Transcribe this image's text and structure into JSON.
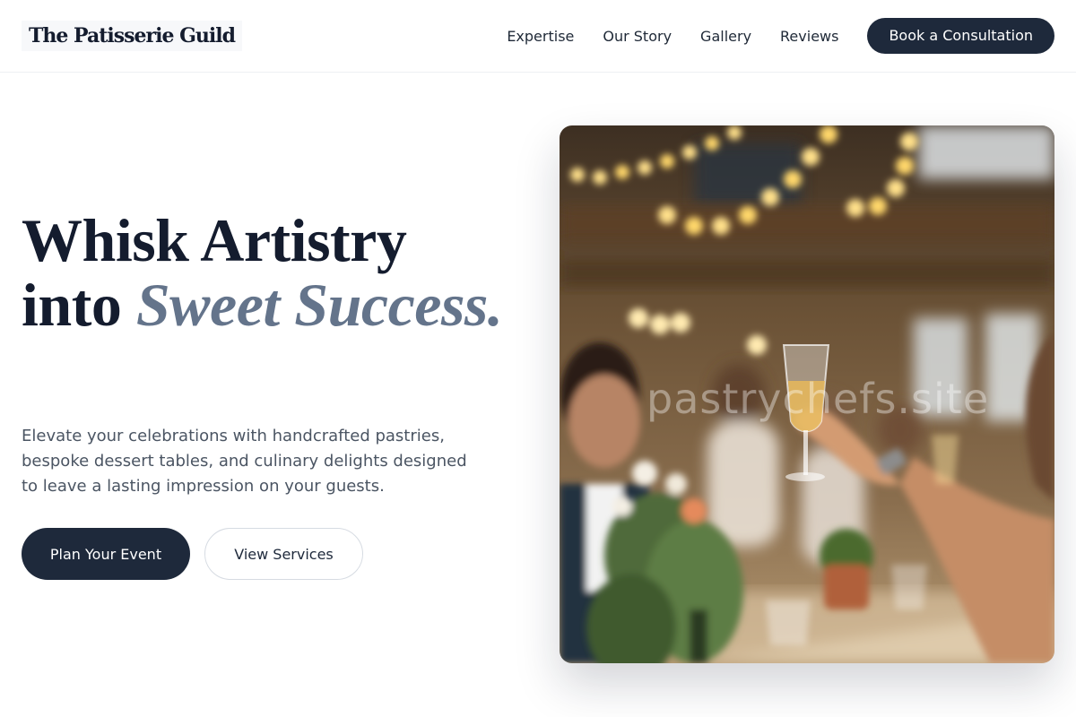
{
  "header": {
    "logo": "The Patisserie Guild",
    "nav": [
      "Expertise",
      "Our Story",
      "Gallery",
      "Reviews"
    ],
    "cta": "Book a Consultation"
  },
  "hero": {
    "headline_line1": "Whisk Artistry",
    "headline_into": "into ",
    "headline_accent": "Sweet Success.",
    "description": "Elevate your celebrations with handcrafted pastries, bespoke dessert tables, and culinary delights designed to leave a lasting impression on your guests.",
    "primary_button": "Plan Your Event",
    "secondary_button": "View Services"
  },
  "photo": {
    "watermark": "pastrychefs.site"
  },
  "colors": {
    "brand_dark": "#1e293b",
    "accent_gray": "#64748b"
  }
}
